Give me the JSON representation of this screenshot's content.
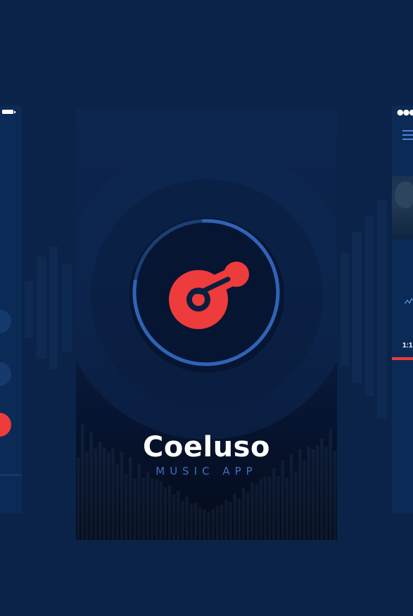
{
  "app": {
    "name": "Coeluso",
    "tagline": "MUSIC APP"
  },
  "right_screen": {
    "time_elapsed": "1:1"
  },
  "icons": {
    "logo": "coeluso-logo-icon",
    "battery": "battery-icon",
    "signal": "signal-dots-icon",
    "menu": "menu-icon",
    "pulse": "pulse-icon"
  },
  "colors": {
    "background": "#0b2348",
    "accent_red": "#ee3b3b",
    "accent_blue": "#3f6fc4",
    "text": "#ffffff"
  },
  "loader": {
    "progress": 0.78
  }
}
